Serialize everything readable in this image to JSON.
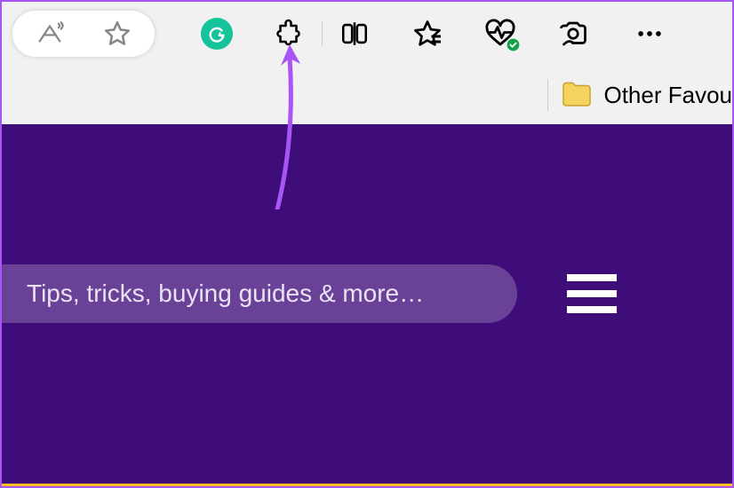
{
  "toolbar": {
    "read_aloud": "read-aloud",
    "favorite": "favorite-star",
    "grammarly": "grammarly",
    "extensions": "extensions",
    "split_screen": "split-screen",
    "collections": "collections",
    "heart_pulse": "performance",
    "screenshot": "screenshot",
    "more": "more"
  },
  "bookmarks": {
    "other_label": "Other Favou"
  },
  "page": {
    "search_placeholder": "Tips, tricks, buying guides & more…"
  }
}
